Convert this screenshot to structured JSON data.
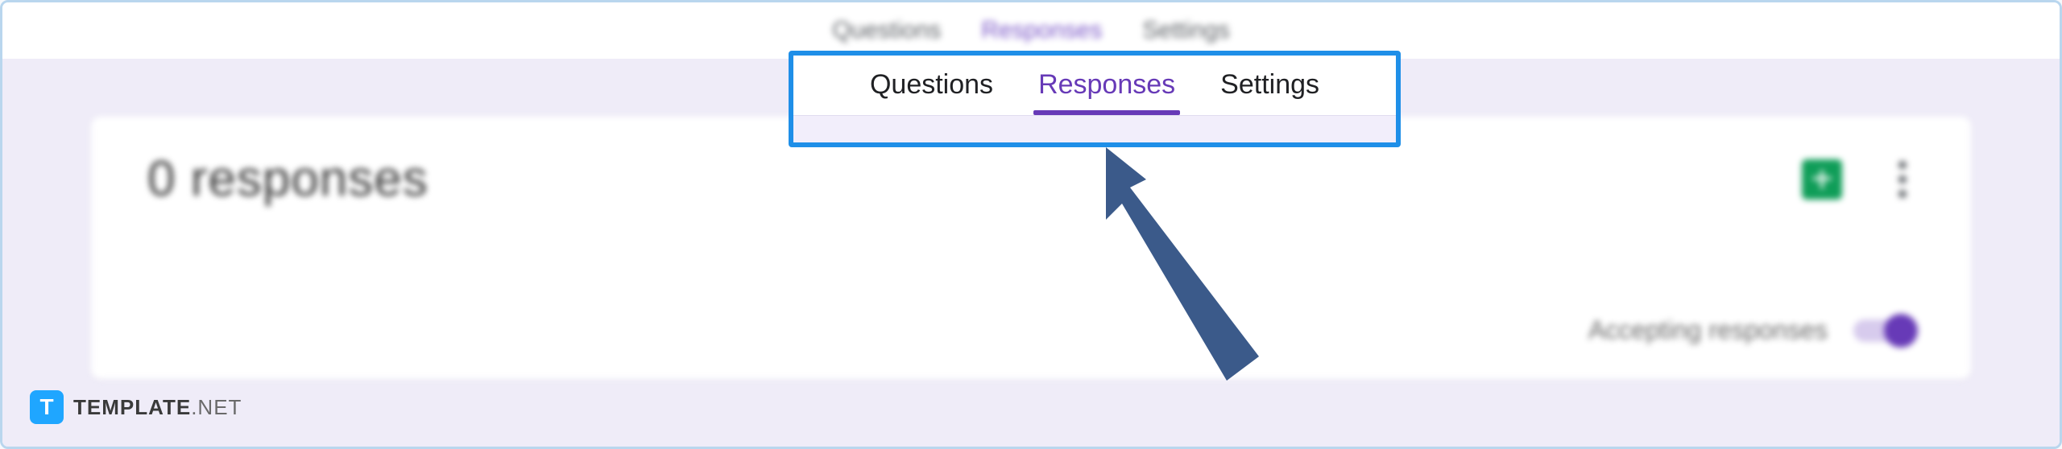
{
  "tabs_blur": {
    "questions": "Questions",
    "responses": "Responses",
    "settings": "Settings"
  },
  "callout_tabs": {
    "questions": "Questions",
    "responses": "Responses",
    "settings": "Settings"
  },
  "card": {
    "title": "0 responses",
    "accepting_label": "Accepting responses"
  },
  "watermark": {
    "icon_letter": "T",
    "brand": "TEMPLATE",
    "suffix": ".NET"
  },
  "colors": {
    "accent": "#673ab7",
    "callout_border": "#1f8fe8",
    "arrow": "#3b5a8a",
    "sheets_green": "#0f9d58"
  }
}
